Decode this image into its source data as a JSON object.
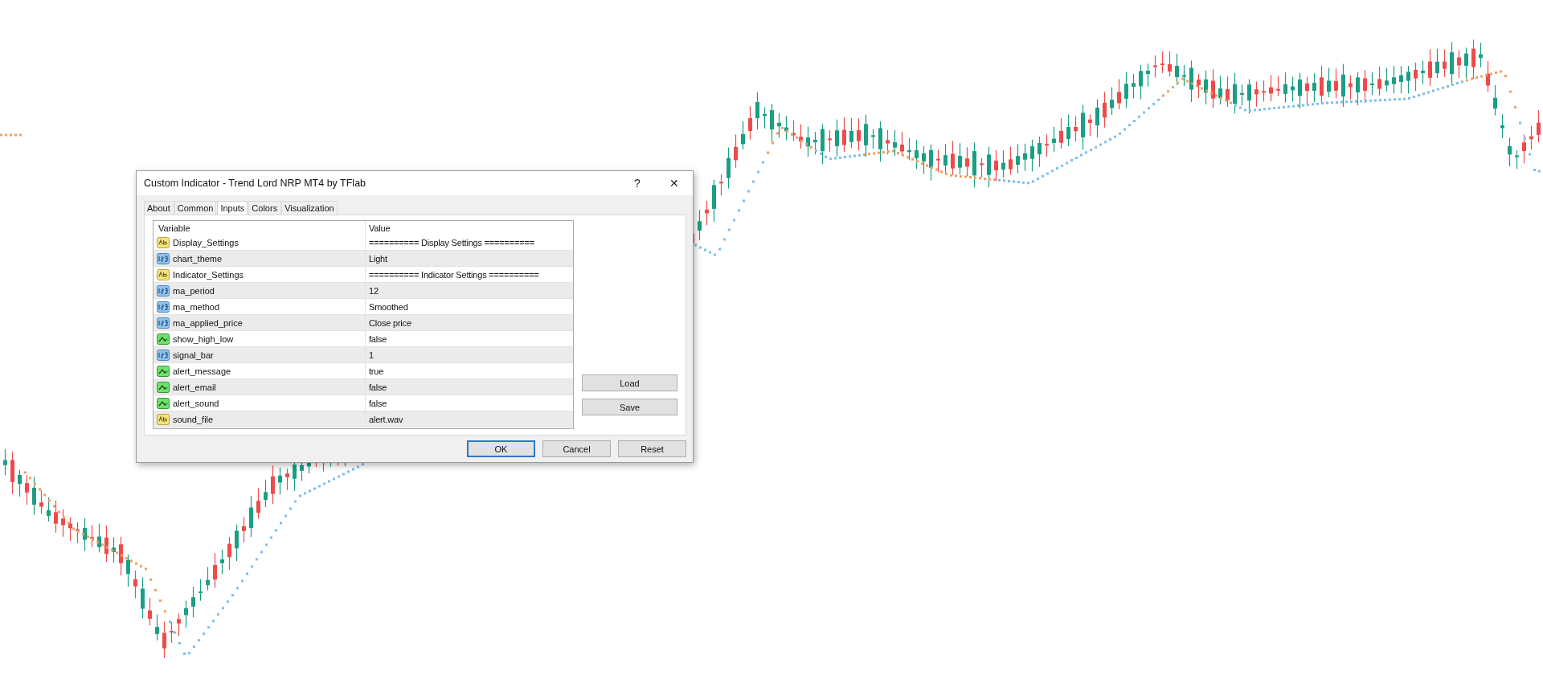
{
  "window": {
    "title": "Custom Indicator - Trend Lord NRP MT4 by TFlab",
    "help": "?",
    "close": "✕"
  },
  "tabs": [
    {
      "label": "About",
      "selected": false
    },
    {
      "label": "Common",
      "selected": false
    },
    {
      "label": "Inputs",
      "selected": true
    },
    {
      "label": "Colors",
      "selected": false
    },
    {
      "label": "Visualization",
      "selected": false
    }
  ],
  "table": {
    "columns": [
      "Variable",
      "Value"
    ],
    "rows": [
      {
        "kind": "string",
        "variable": "Display_Settings",
        "value": "========== Display Settings =========="
      },
      {
        "kind": "number",
        "variable": "chart_theme",
        "value": "Light"
      },
      {
        "kind": "string",
        "variable": "Indicator_Settings",
        "value": "========== Indicator Settings =========="
      },
      {
        "kind": "number",
        "variable": "ma_period",
        "value": "12"
      },
      {
        "kind": "number",
        "variable": "ma_method",
        "value": "Smoothed"
      },
      {
        "kind": "number",
        "variable": "ma_applied_price",
        "value": "Close price"
      },
      {
        "kind": "bool",
        "variable": "show_high_low",
        "value": "false"
      },
      {
        "kind": "number",
        "variable": "signal_bar",
        "value": "1"
      },
      {
        "kind": "bool",
        "variable": "alert_message",
        "value": "true"
      },
      {
        "kind": "bool",
        "variable": "alert_email",
        "value": "false"
      },
      {
        "kind": "bool",
        "variable": "alert_sound",
        "value": "false"
      },
      {
        "kind": "string",
        "variable": "sound_file",
        "value": "alert.wav"
      }
    ]
  },
  "side_buttons": [
    "Load",
    "Save"
  ],
  "buttons": [
    {
      "label": "OK",
      "default": true
    },
    {
      "label": "Cancel",
      "default": false
    },
    {
      "label": "Reset",
      "default": false
    }
  ]
}
